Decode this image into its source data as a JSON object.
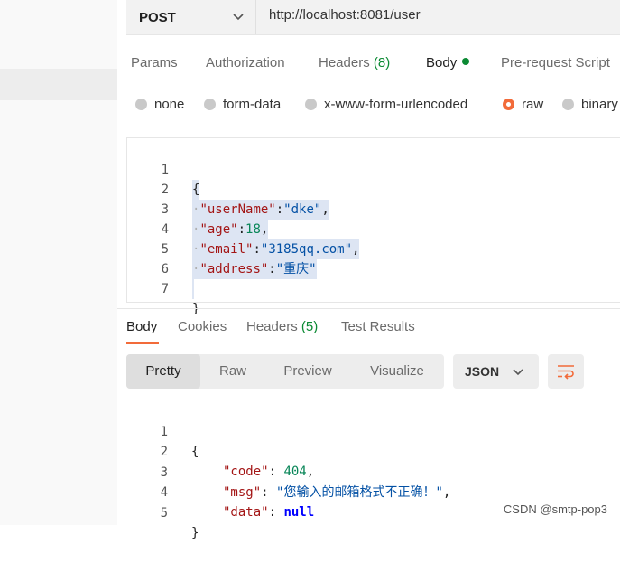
{
  "request": {
    "method": "POST",
    "url": "http://localhost:8081/user",
    "tabs": [
      {
        "label": "Params"
      },
      {
        "label": "Authorization"
      },
      {
        "label": "Headers",
        "count": "(8)"
      },
      {
        "label": "Body"
      },
      {
        "label": "Pre-request Script"
      }
    ],
    "active_tab": "Body",
    "body_types": [
      "none",
      "form-data",
      "x-www-form-urlencoded",
      "raw",
      "binary"
    ],
    "selected_body_type": "raw",
    "body_lines": [
      {
        "n": "1",
        "text": "{"
      },
      {
        "n": "2",
        "text": "\"userName\":\"dke\","
      },
      {
        "n": "3",
        "text": "\"age\":18,"
      },
      {
        "n": "4",
        "text": "\"email\":\"3185qq.com\","
      },
      {
        "n": "5",
        "text": "\"address\":\"重庆\""
      },
      {
        "n": "6",
        "text": ""
      },
      {
        "n": "7",
        "text": "}"
      }
    ]
  },
  "response": {
    "tabs": [
      {
        "label": "Body"
      },
      {
        "label": "Cookies"
      },
      {
        "label": "Headers",
        "count": "(5)"
      },
      {
        "label": "Test Results"
      }
    ],
    "active_tab": "Body",
    "view_modes": [
      "Pretty",
      "Raw",
      "Preview",
      "Visualize"
    ],
    "active_view": "Pretty",
    "format": "JSON",
    "body_lines": [
      {
        "n": "1",
        "text": "{"
      },
      {
        "n": "2",
        "text": "\"code\": 404,"
      },
      {
        "n": "3",
        "text": "\"msg\": \"您输入的邮箱格式不正确！\","
      },
      {
        "n": "4",
        "text": "\"data\": null"
      },
      {
        "n": "5",
        "text": "}"
      }
    ]
  },
  "watermark": "CSDN @smtp-pop3",
  "colors": {
    "accent": "#f26b3a",
    "count_green": "#0b8a33",
    "selection_highlight": "#dde5f3",
    "json_key": "#a31515",
    "json_string": "#0451a5",
    "json_number": "#098658"
  },
  "icons": [
    "chevron-down-icon",
    "wrap-lines-icon"
  ]
}
